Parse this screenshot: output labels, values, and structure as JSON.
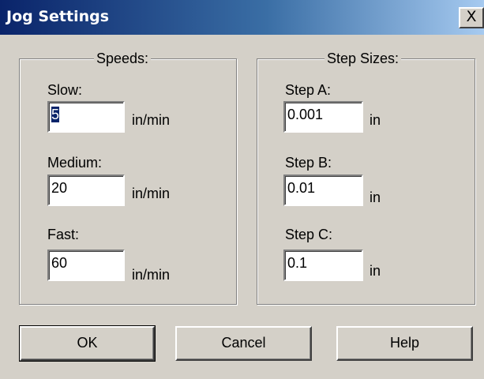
{
  "window": {
    "title": "Jog Settings",
    "close_label": "X"
  },
  "speeds": {
    "legend": "Speeds:",
    "slow": {
      "label": "Slow:",
      "value": "5",
      "unit": "in/min"
    },
    "medium": {
      "label": "Medium:",
      "value": "20",
      "unit": "in/min"
    },
    "fast": {
      "label": "Fast:",
      "value": "60",
      "unit": "in/min"
    }
  },
  "step_sizes": {
    "legend": "Step Sizes:",
    "step_a": {
      "label": "Step A:",
      "value": "0.001",
      "unit": "in"
    },
    "step_b": {
      "label": "Step B:",
      "value": "0.01",
      "unit": "in"
    },
    "step_c": {
      "label": "Step C:",
      "value": "0.1",
      "unit": "in"
    }
  },
  "buttons": {
    "ok": "OK",
    "cancel": "Cancel",
    "help": "Help"
  },
  "colors": {
    "title_gradient_start": "#0a246a",
    "title_gradient_end": "#a6caf0",
    "dialog_face": "#d4d0c8",
    "selection": "#0a246a"
  }
}
